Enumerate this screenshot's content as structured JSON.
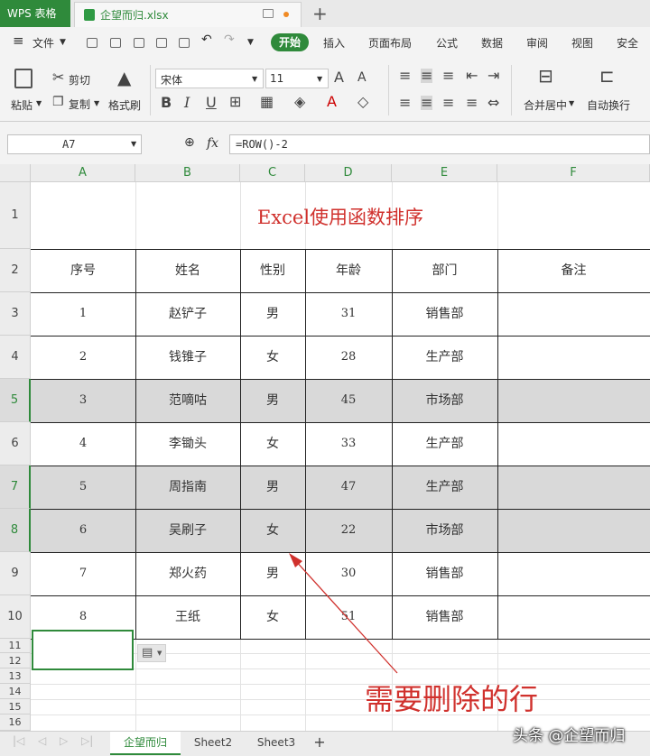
{
  "titlebar": {
    "app_label": "WPS 表格",
    "file_name": "企望而归.xlsx",
    "new_tab_glyph": "+"
  },
  "menu": {
    "file": "文件",
    "tabs": [
      "开始",
      "插入",
      "页面布局",
      "公式",
      "数据",
      "审阅",
      "视图",
      "安全"
    ]
  },
  "ribbon": {
    "paste": "粘贴",
    "cut": "剪切",
    "copy": "复制",
    "format_painter": "格式刷",
    "font_name": "宋体",
    "font_size": "11",
    "merge_center": "合并居中",
    "wrap_text": "自动换行"
  },
  "formula_bar": {
    "cell_ref": "A7",
    "fx_label": "fx",
    "formula": "=ROW()-2"
  },
  "grid": {
    "columns": [
      "A",
      "B",
      "C",
      "D",
      "E",
      "F"
    ],
    "rows": [
      "1",
      "2",
      "3",
      "4",
      "5",
      "6",
      "7",
      "8",
      "9",
      "10",
      "11",
      "12",
      "13",
      "14",
      "15",
      "16"
    ],
    "selected_rows": [
      "5",
      "7",
      "8"
    ],
    "title": "Excel使用函数排序",
    "headers": [
      "序号",
      "姓名",
      "性别",
      "年龄",
      "部门",
      "备注"
    ],
    "data": [
      [
        "1",
        "赵铲子",
        "男",
        "31",
        "销售部"
      ],
      [
        "2",
        "钱锥子",
        "女",
        "28",
        "生产部"
      ],
      [
        "3",
        "范嘀咕",
        "男",
        "45",
        "市场部"
      ],
      [
        "4",
        "李锄头",
        "女",
        "33",
        "生产部"
      ],
      [
        "5",
        "周指南",
        "男",
        "47",
        "生产部"
      ],
      [
        "6",
        "吴刷子",
        "女",
        "22",
        "市场部"
      ],
      [
        "7",
        "郑火药",
        "男",
        "30",
        "销售部"
      ],
      [
        "8",
        "王纸",
        "女",
        "51",
        "销售部"
      ]
    ]
  },
  "annotation": "需要删除的行",
  "sheet_tabs": [
    "企望而归",
    "Sheet2",
    "Sheet3"
  ],
  "sheet_add": "+",
  "watermark": "头条 @企望而归",
  "colors": {
    "accent": "#2f8a3b",
    "title_red": "#d0312d",
    "row_shade": "#d9d9d9"
  }
}
